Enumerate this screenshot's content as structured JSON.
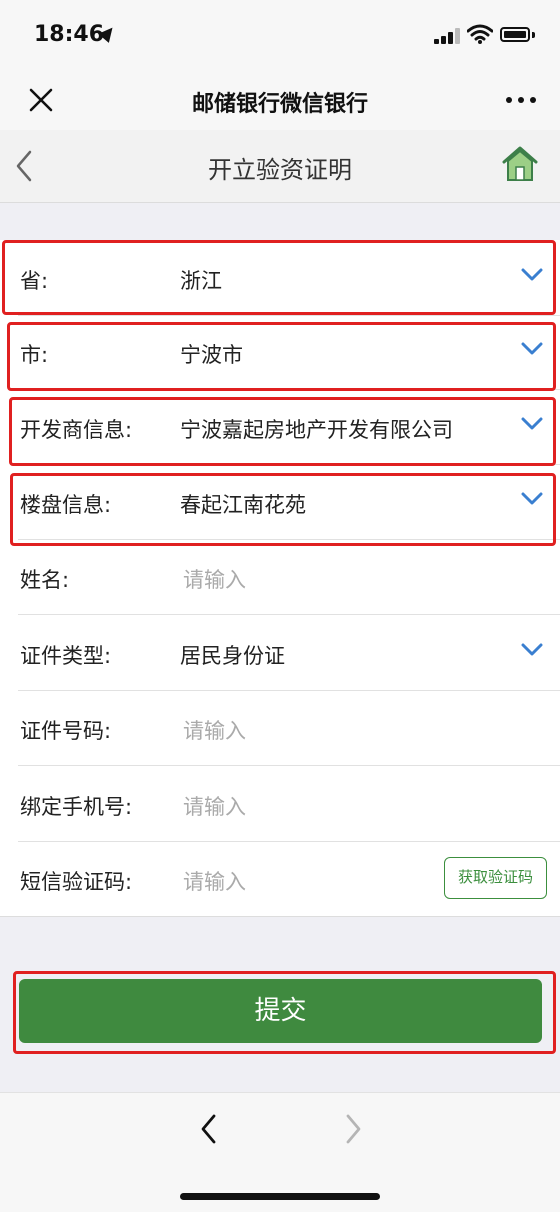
{
  "status_bar": {
    "time": "18:46"
  },
  "wechat_nav": {
    "title": "邮储银行微信银行"
  },
  "page": {
    "title": "开立验资证明"
  },
  "form": {
    "province": {
      "label": "省:",
      "value": "浙江"
    },
    "city": {
      "label": "市:",
      "value": "宁波市"
    },
    "developer": {
      "label": "开发商信息:",
      "value": "宁波嘉起房地产开发有限公司"
    },
    "property": {
      "label": "楼盘信息:",
      "value": "春起江南花苑"
    },
    "name": {
      "label": "姓名:",
      "placeholder": "请输入"
    },
    "id_type": {
      "label": "证件类型:",
      "value": "居民身份证"
    },
    "id_number": {
      "label": "证件号码:",
      "placeholder": "请输入"
    },
    "phone": {
      "label": "绑定手机号:",
      "placeholder": "请输入"
    },
    "sms_code": {
      "label": "短信验证码:",
      "placeholder": "请输入",
      "button": "获取验证码"
    }
  },
  "submit": {
    "label": "提交"
  },
  "colors": {
    "accent_green": "#3f8a3f",
    "chevron_blue": "#3a7fd0",
    "highlight_red": "#e02020"
  }
}
